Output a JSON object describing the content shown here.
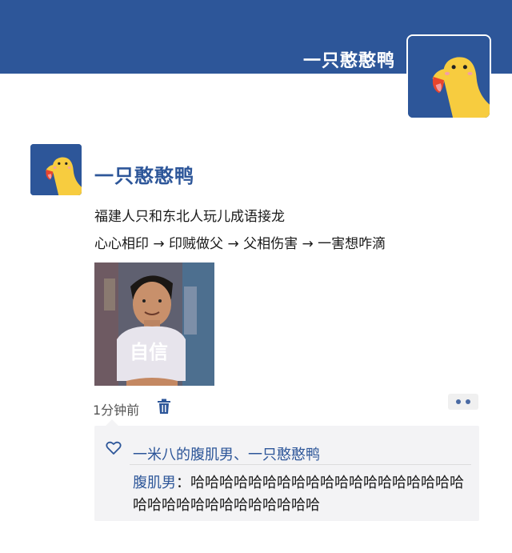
{
  "profile": {
    "name": "一只憨憨鸭",
    "avatar": "duck-avatar",
    "cover_color": "#2d5699"
  },
  "post": {
    "author": "一只憨憨鸭",
    "avatar": "duck-avatar",
    "lines": [
      "福建人只和东北人玩儿成语接龙",
      "心心相印 → 印贼做父 → 父相伤害 → 一害想咋滴"
    ],
    "image": {
      "icon": "meme-photo",
      "caption": "自信"
    },
    "time": "1分钟前",
    "delete_icon": "trash-icon",
    "more_icon": "more-dots-icon"
  },
  "interactions": {
    "like_icon": "heart-icon",
    "likes": "一米八的腹肌男、一只憨憨鸭",
    "comments": [
      {
        "user": "腹肌男",
        "separator": "：",
        "text": "哈哈哈哈哈哈哈哈哈哈哈哈哈哈哈哈哈哈哈哈哈哈哈哈哈哈哈哈哈哈哈哈"
      }
    ]
  },
  "colors": {
    "brand_blue": "#2d5699",
    "duck_yellow": "#f7cc3f"
  }
}
